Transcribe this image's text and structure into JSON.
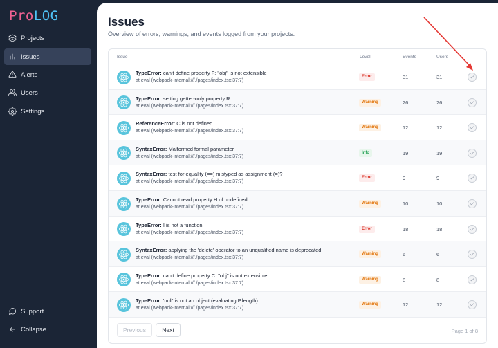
{
  "app": {
    "logo_pro": "Pro",
    "logo_log": "LOG"
  },
  "sidebar": {
    "items": [
      {
        "label": "Projects",
        "icon": "layers-icon"
      },
      {
        "label": "Issues",
        "icon": "bar-chart-icon",
        "active": true
      },
      {
        "label": "Alerts",
        "icon": "alert-triangle-icon"
      },
      {
        "label": "Users",
        "icon": "users-icon"
      },
      {
        "label": "Settings",
        "icon": "gear-icon"
      }
    ],
    "bottom": [
      {
        "label": "Support",
        "icon": "chat-bubble-icon"
      },
      {
        "label": "Collapse",
        "icon": "arrow-left-icon"
      }
    ]
  },
  "header": {
    "title": "Issues",
    "subtitle": "Overview of errors, warnings, and events logged from your projects."
  },
  "table": {
    "columns": {
      "issue": "Issue",
      "level": "Level",
      "events": "Events",
      "users": "Users"
    },
    "rows": [
      {
        "type": "TypeError:",
        "message": " can't define property F: \"obj\" is not extensible",
        "location": "at eval (webpack-internal:///./pages/index.tsx:37:7)",
        "level": "Error",
        "level_kind": "error",
        "events": "31",
        "users": "31"
      },
      {
        "type": "TypeError:",
        "message": " setting getter-only property R",
        "location": "at eval (webpack-internal:///./pages/index.tsx:37:7)",
        "level": "Warning",
        "level_kind": "warning",
        "events": "26",
        "users": "26"
      },
      {
        "type": "ReferenceError:",
        "message": " C is not defined",
        "location": "at eval (webpack-internal:///./pages/index.tsx:37:7)",
        "level": "Warning",
        "level_kind": "warning",
        "events": "12",
        "users": "12"
      },
      {
        "type": "SyntaxError:",
        "message": " Malformed formal parameter",
        "location": "at eval (webpack-internal:///./pages/index.tsx:37:7)",
        "level": "Info",
        "level_kind": "info",
        "events": "19",
        "users": "19"
      },
      {
        "type": "SyntaxError:",
        "message": " test for equality (==) mistyped as assignment (=)?",
        "location": "at eval (webpack-internal:///./pages/index.tsx:37:7)",
        "level": "Error",
        "level_kind": "error",
        "events": "9",
        "users": "9"
      },
      {
        "type": "TypeError:",
        "message": " Cannot read property H of undefined",
        "location": "at eval (webpack-internal:///./pages/index.tsx:37:7)",
        "level": "Warning",
        "level_kind": "warning",
        "events": "10",
        "users": "10"
      },
      {
        "type": "TypeError:",
        "message": " I is not a function",
        "location": "at eval (webpack-internal:///./pages/index.tsx:37:7)",
        "level": "Error",
        "level_kind": "error",
        "events": "18",
        "users": "18"
      },
      {
        "type": "SyntaxError:",
        "message": " applying the 'delete' operator to an unqualified name is deprecated",
        "location": "at eval (webpack-internal:///./pages/index.tsx:37:7)",
        "level": "Warning",
        "level_kind": "warning",
        "events": "6",
        "users": "6"
      },
      {
        "type": "TypeError:",
        "message": " can't define property C: \"obj\" is not extensible",
        "location": "at eval (webpack-internal:///./pages/index.tsx:37:7)",
        "level": "Warning",
        "level_kind": "warning",
        "events": "8",
        "users": "8"
      },
      {
        "type": "TypeError:",
        "message": " 'null' is not an object (evaluating P.length)",
        "location": "at eval (webpack-internal:///./pages/index.tsx:37:7)",
        "level": "Warning",
        "level_kind": "warning",
        "events": "12",
        "users": "12"
      }
    ]
  },
  "pagination": {
    "previous": "Previous",
    "next": "Next",
    "page_info": "Page 1 of 8"
  },
  "colors": {
    "sidebar_bg": "#1b2536",
    "annotation_arrow": "#e53935",
    "react_icon": "#58c4dc"
  }
}
